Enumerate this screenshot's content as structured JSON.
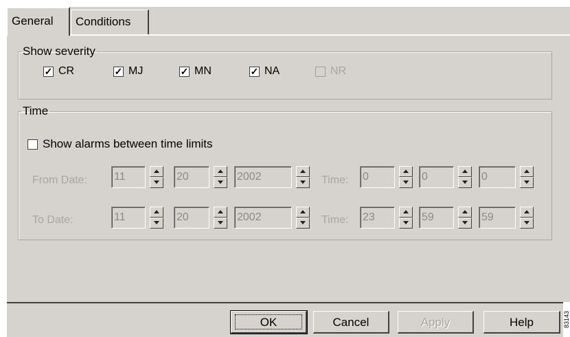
{
  "tabs": [
    {
      "label": "General",
      "active": true
    },
    {
      "label": "Conditions",
      "active": false
    }
  ],
  "severity": {
    "title": "Show severity",
    "items": [
      {
        "label": "CR",
        "checked": true,
        "enabled": true
      },
      {
        "label": "MJ",
        "checked": true,
        "enabled": true
      },
      {
        "label": "MN",
        "checked": true,
        "enabled": true
      },
      {
        "label": "NA",
        "checked": true,
        "enabled": true
      },
      {
        "label": "NR",
        "checked": false,
        "enabled": false
      }
    ]
  },
  "time": {
    "title": "Time",
    "limit_checkbox": {
      "label": "Show alarms between time limits",
      "checked": false
    },
    "from_label": "From Date:",
    "to_label": "To Date:",
    "time_label": "Time:",
    "from": {
      "month": "11",
      "day": "20",
      "year": "2002",
      "hour": "0",
      "minute": "0",
      "second": "0"
    },
    "to": {
      "month": "11",
      "day": "20",
      "year": "2002",
      "hour": "23",
      "minute": "59",
      "second": "59"
    }
  },
  "buttons": {
    "ok": "OK",
    "cancel": "Cancel",
    "apply": "Apply",
    "help": "Help"
  },
  "side_mark": "83143"
}
